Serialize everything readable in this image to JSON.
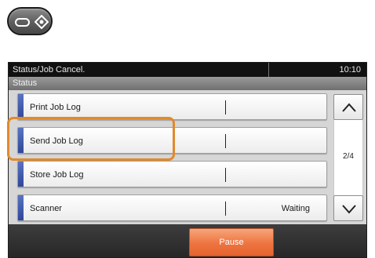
{
  "hardware_key": {
    "icon": "status-job-cancel-key-icon"
  },
  "panel": {
    "title": "Status/Job Cancel.",
    "time": "10:10",
    "section": "Status",
    "rows": [
      {
        "label": "Print Job Log",
        "status": ""
      },
      {
        "label": "Send Job Log",
        "status": ""
      },
      {
        "label": "Store Job Log",
        "status": ""
      },
      {
        "label": "Scanner",
        "status": "Waiting"
      }
    ],
    "page_indicator": "2/4",
    "pause_label": "Pause"
  },
  "colors": {
    "row_accent": "#3a52a8",
    "highlight": "#e08a2c",
    "pause_button": "#ee7440"
  }
}
